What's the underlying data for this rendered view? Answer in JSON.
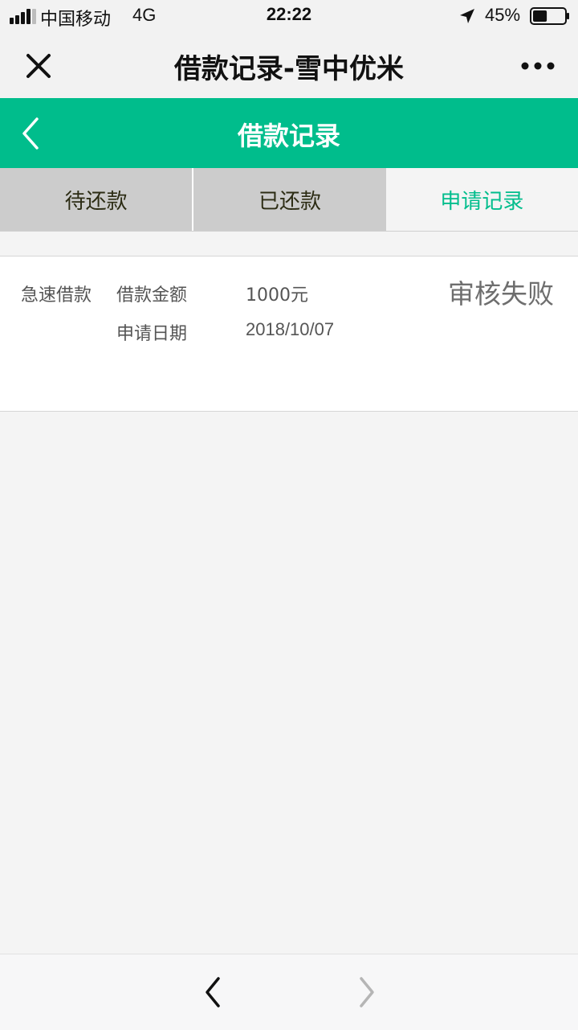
{
  "status_bar": {
    "carrier": "中国移动",
    "network": "4G",
    "time": "22:22",
    "battery_percent": "45%",
    "battery_level": 0.45,
    "icons": [
      "signal-icon",
      "location-arrow-icon",
      "battery-icon"
    ]
  },
  "title_bar": {
    "title": "借款记录-雪中优米",
    "icons": [
      "close-icon",
      "more-dots-icon"
    ]
  },
  "header": {
    "title": "借款记录",
    "icons": [
      "chevron-left-icon"
    ]
  },
  "tabs": [
    {
      "label": "待还款",
      "active": false
    },
    {
      "label": "已还款",
      "active": false
    },
    {
      "label": "申请记录",
      "active": true
    }
  ],
  "record": {
    "type": "急速借款",
    "amount_label": "借款金额",
    "amount_value": "1000元",
    "date_label": "申请日期",
    "date_value": "2018/10/07",
    "status": "审核失败"
  },
  "bottom_nav": {
    "icons": [
      "chevron-left-icon",
      "chevron-right-icon"
    ]
  },
  "colors": {
    "accent": "#00bd8c",
    "tab_inactive_bg": "#cccccc",
    "page_bg": "#f4f4f4",
    "status_text": "#6e6e6e"
  }
}
